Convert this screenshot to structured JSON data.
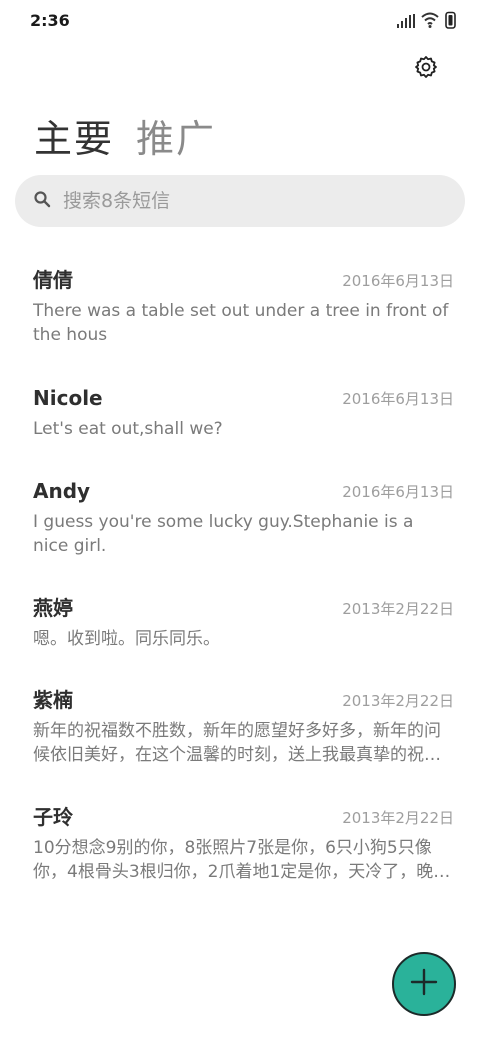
{
  "status": {
    "time": "2:36",
    "icons": [
      "signal-icon",
      "wifi-icon",
      "battery-icon"
    ]
  },
  "header": {
    "settings_icon": "gear-icon",
    "tabs": [
      {
        "label": "主要",
        "active": true
      },
      {
        "label": "推广",
        "active": false
      }
    ]
  },
  "search": {
    "placeholder": "搜索8条短信",
    "icon": "search-icon"
  },
  "messages": [
    {
      "name": "倩倩",
      "date": "2016年6月13日",
      "snippet": "There was a table set out under a tree in front of the hous"
    },
    {
      "name": "Nicole",
      "date": "2016年6月13日",
      "snippet": "Let's eat out,shall we?"
    },
    {
      "name": "Andy",
      "date": "2016年6月13日",
      "snippet": "I guess you're some lucky guy.Stephanie is a nice girl."
    },
    {
      "name": "燕婷",
      "date": "2013年2月22日",
      "snippet": "嗯。收到啦。同乐同乐。"
    },
    {
      "name": "紫楠",
      "date": "2013年2月22日",
      "snippet": "新年的祝福数不胜数，新年的愿望好多好多，新年的问候依旧美好，在这个温馨的时刻，送上我最真挚的祝…"
    },
    {
      "name": "子玲",
      "date": "2013年2月22日",
      "snippet": "10分想念9别的你，8张照片7张是你，6只小狗5只像你，4根骨头3根归你，2爪着地1定是你，天冷了，晚…"
    }
  ],
  "fab": {
    "icon": "plus-icon"
  },
  "colors": {
    "accent": "#2ab29a",
    "search_bg": "#ececec"
  }
}
